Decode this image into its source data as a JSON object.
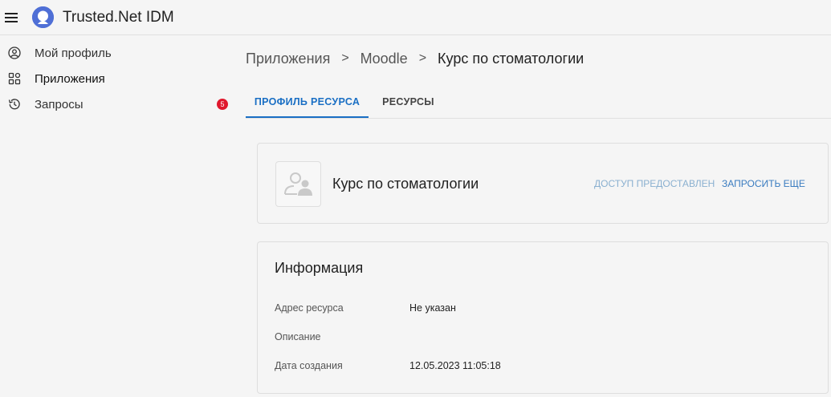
{
  "app": {
    "title": "Trusted.Net IDM"
  },
  "icons": {
    "menu": "menu-icon",
    "logo": "logo-icon",
    "profile": "account-circle-icon",
    "apps": "apps-grid-icon",
    "requests": "history-icon",
    "resource_avatar": "users-placeholder-icon"
  },
  "sidebar": {
    "items": [
      {
        "label": "Мой профиль"
      },
      {
        "label": "Приложения"
      },
      {
        "label": "Запросы",
        "badge": "5"
      }
    ]
  },
  "breadcrumb": {
    "items": [
      "Приложения",
      "Moodle"
    ],
    "current": "Курс по стоматологии",
    "separator": ">"
  },
  "tabs": [
    {
      "label": "ПРОФИЛЬ РЕСУРСА",
      "active": true
    },
    {
      "label": "РЕСУРСЫ",
      "active": false
    }
  ],
  "resource_card": {
    "title": "Курс по стоматологии",
    "access_status": "ДОСТУП ПРЕДОСТАВЛЕН",
    "request_more": "ЗАПРОСИТЬ ЕЩЕ"
  },
  "info_card": {
    "title": "Информация",
    "rows": [
      {
        "key": "Адрес ресурса",
        "value": "Не указан"
      },
      {
        "key": "Описание",
        "value": ""
      },
      {
        "key": "Дата создания",
        "value": "12.05.2023 11:05:18"
      }
    ]
  },
  "colors": {
    "accent": "#1a6fc4",
    "badge": "#e0182d",
    "logo": "#4f6fd6",
    "status_muted": "#8ab0d0"
  }
}
